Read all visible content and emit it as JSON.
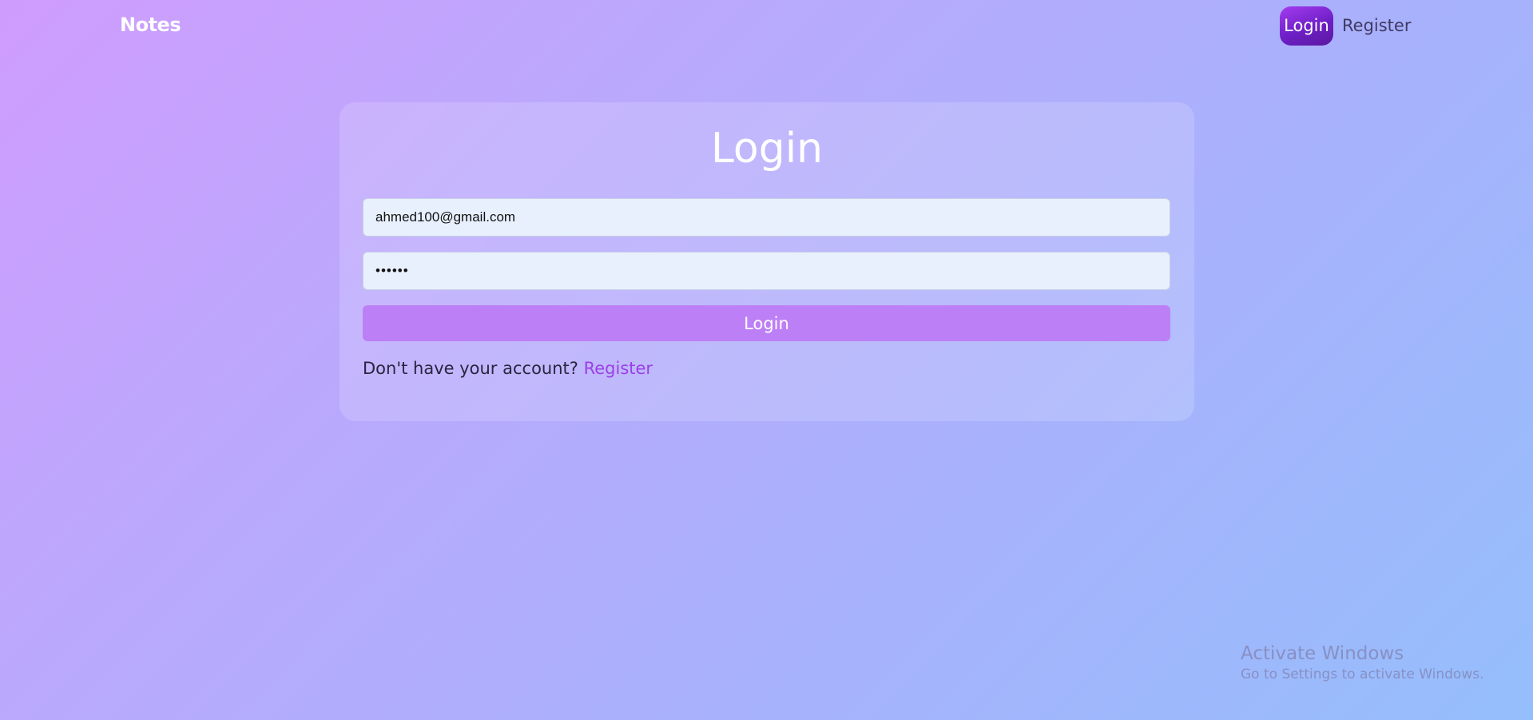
{
  "navbar": {
    "brand": "Notes",
    "login_label": "Login",
    "register_label": "Register"
  },
  "login_form": {
    "title": "Login",
    "email": {
      "value": "ahmed100@gmail.com",
      "placeholder": ""
    },
    "password": {
      "value": "••••••",
      "placeholder": ""
    },
    "submit_label": "Login",
    "footer_text": "Don't have your account?",
    "footer_link_label": "Register"
  },
  "watermark": {
    "title": "Activate Windows",
    "subtitle": "Go to Settings to activate Windows."
  },
  "colors": {
    "gradient_start": "#cf9cfd",
    "gradient_end": "#95befc",
    "nav_login_bg": "#7a24d0",
    "submit_bg": "#bd7ff6",
    "link": "#9b3fe6",
    "input_bg": "#e8f0fd"
  }
}
